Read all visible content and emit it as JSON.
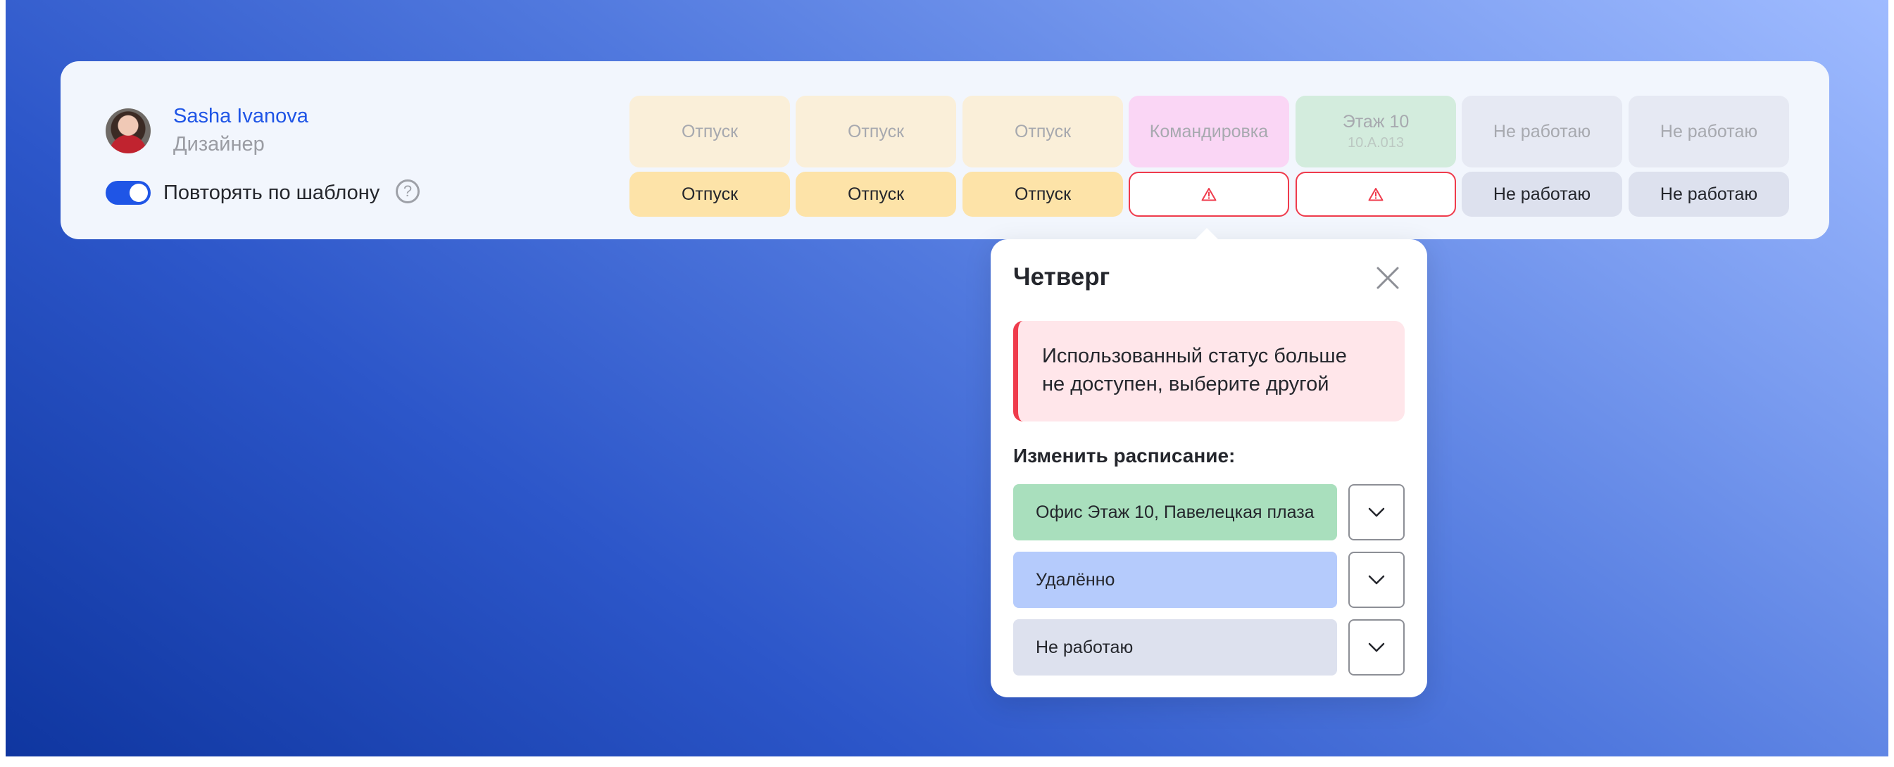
{
  "user": {
    "name": "Sasha Ivanova",
    "role": "Дизайнер",
    "repeat_label": "Повторять по шаблону",
    "help_glyph": "?"
  },
  "schedule": {
    "top": [
      {
        "label": "Отпуск",
        "sub": "",
        "bg": "#faefd9"
      },
      {
        "label": "Отпуск",
        "sub": "",
        "bg": "#faefd9"
      },
      {
        "label": "Отпуск",
        "sub": "",
        "bg": "#faefd9"
      },
      {
        "label": "Командировка",
        "sub": "",
        "bg": "#fad6f5"
      },
      {
        "label": "Этаж 10",
        "sub": "10.A.013",
        "bg": "#d3ecdd"
      },
      {
        "label": "Не работаю",
        "sub": "",
        "bg": "#e6e9f3"
      },
      {
        "label": "Не работаю",
        "sub": "",
        "bg": "#e6e9f3"
      }
    ],
    "bottom": [
      {
        "label": "Отпуск",
        "bg": "#fde3a8",
        "warning": false
      },
      {
        "label": "Отпуск",
        "bg": "#fde3a8",
        "warning": false
      },
      {
        "label": "Отпуск",
        "bg": "#fde3a8",
        "warning": false
      },
      {
        "label": "",
        "bg": "#ffffff",
        "warning": true
      },
      {
        "label": "",
        "bg": "#ffffff",
        "warning": true
      },
      {
        "label": "Не работаю",
        "bg": "#dde1ee",
        "warning": false
      },
      {
        "label": "Не работаю",
        "bg": "#dde1ee",
        "warning": false
      }
    ]
  },
  "popover": {
    "title": "Четверг",
    "alert_line1": "Использованный статус больше",
    "alert_line2": "не доступен, выберите другой",
    "section_label": "Изменить расписание:",
    "options": [
      {
        "label": "Офис Этаж 10, Павелецкая плаза",
        "bg": "#a9dfbd"
      },
      {
        "label": "Удалённо",
        "bg": "#b5cbfc"
      },
      {
        "label": "Не работаю",
        "bg": "#dde1ee"
      }
    ]
  },
  "colors": {
    "accent": "#1f55e6",
    "error": "#ef3b4c"
  }
}
